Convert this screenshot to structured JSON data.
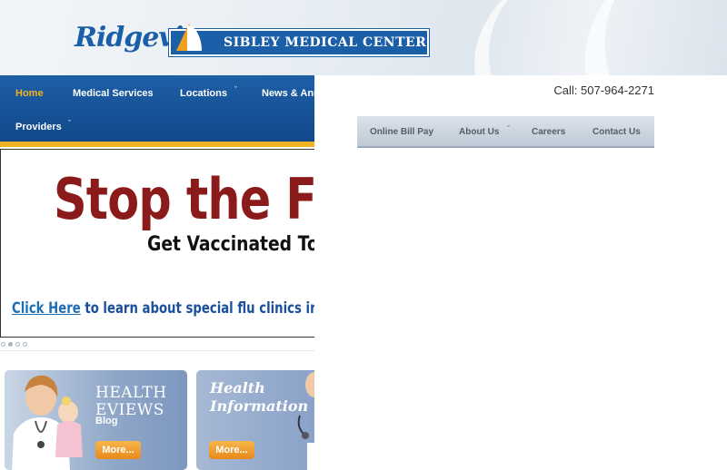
{
  "header": {
    "logo_script": "Ridgeview",
    "logo_name": "SIBLEY MEDICAL CENTER"
  },
  "phone": "Call: 507-964-2271",
  "nav": {
    "items": [
      {
        "label": "Home"
      },
      {
        "label": "Medical Services"
      },
      {
        "label": "Locations"
      },
      {
        "label": "News & Ann"
      },
      {
        "label": "Providers"
      }
    ]
  },
  "subnav": {
    "items": [
      {
        "label": "Online Bill Pay"
      },
      {
        "label": "About Us"
      },
      {
        "label": "Careers"
      },
      {
        "label": "Contact Us"
      }
    ]
  },
  "banner": {
    "title": "Stop the Flu",
    "subtitle": "Get Vaccinated Toda",
    "link_click": "Click Here",
    "link_rest": " to learn about special flu clinics in your"
  },
  "slider": {
    "count": 4,
    "active": 2
  },
  "promos": [
    {
      "title_line1": "HEALTH",
      "title_line2": "EVIEWS",
      "subtitle": "Blog",
      "button": "More..."
    },
    {
      "title_line1": "Health",
      "title_line2": "Information",
      "button": "More..."
    }
  ],
  "colors": {
    "nav_bg": "#1a5aa0",
    "nav_active": "#f5b320",
    "accent_gold": "#f0b323",
    "banner_red": "#8b1a1a",
    "link_blue": "#1f6fb5",
    "button_orange": "#f0a030"
  }
}
